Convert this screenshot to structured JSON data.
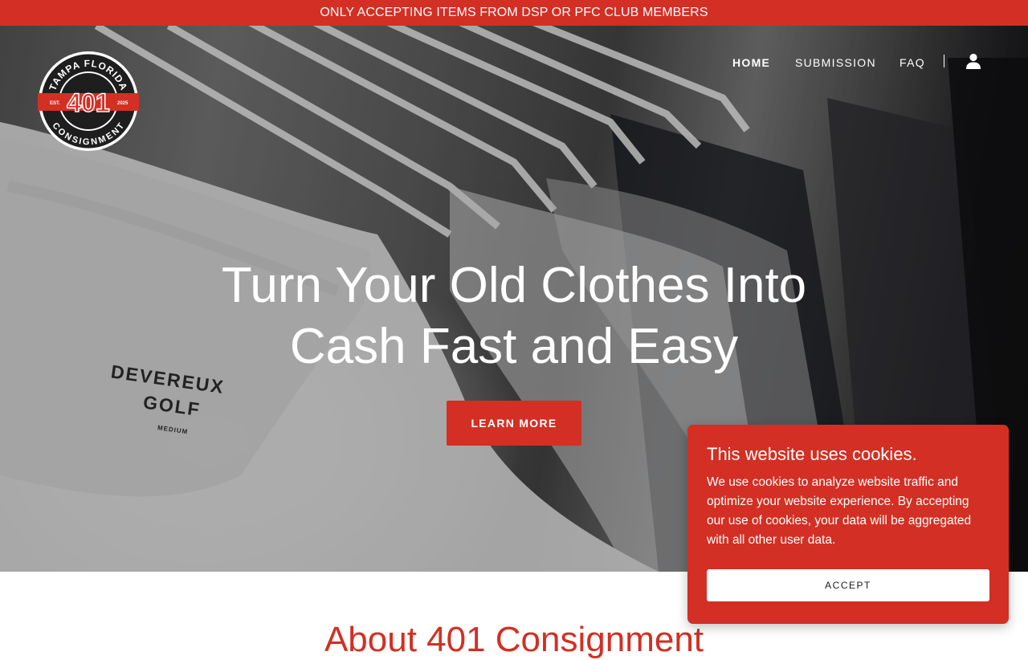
{
  "announcement": {
    "text": "ONLY ACCEPTING ITEMS FROM DSP OR PFC CLUB MEMBERS"
  },
  "logo": {
    "top_text": "TAMPA FLORIDA",
    "number": "401",
    "bottom_text": "CONSIGNMENT",
    "left_badge": "EST.",
    "right_badge": "2025"
  },
  "nav": {
    "items": [
      {
        "label": "HOME",
        "active": true
      },
      {
        "label": "SUBMISSION",
        "active": false
      },
      {
        "label": "FAQ",
        "active": false
      }
    ],
    "account_icon": "user-icon"
  },
  "hero": {
    "headline_line1": "Turn Your Old Clothes Into",
    "headline_line2": "Cash Fast and Easy",
    "cta_label": "LEARN MORE",
    "shirt_brand": "DEVEREUX",
    "shirt_brand2": "GOLF",
    "shirt_size": "MEDIUM"
  },
  "about": {
    "title": "About 401 Consignment"
  },
  "cookie": {
    "title": "This website uses cookies.",
    "body": "We use cookies to analyze website traffic and optimize your website experience. By accepting our use of cookies, your data will be aggregated with all other user data.",
    "accept_label": "ACCEPT"
  },
  "colors": {
    "brand_red": "#d32f24",
    "white": "#ffffff",
    "logo_dark": "#1e1e1e"
  }
}
